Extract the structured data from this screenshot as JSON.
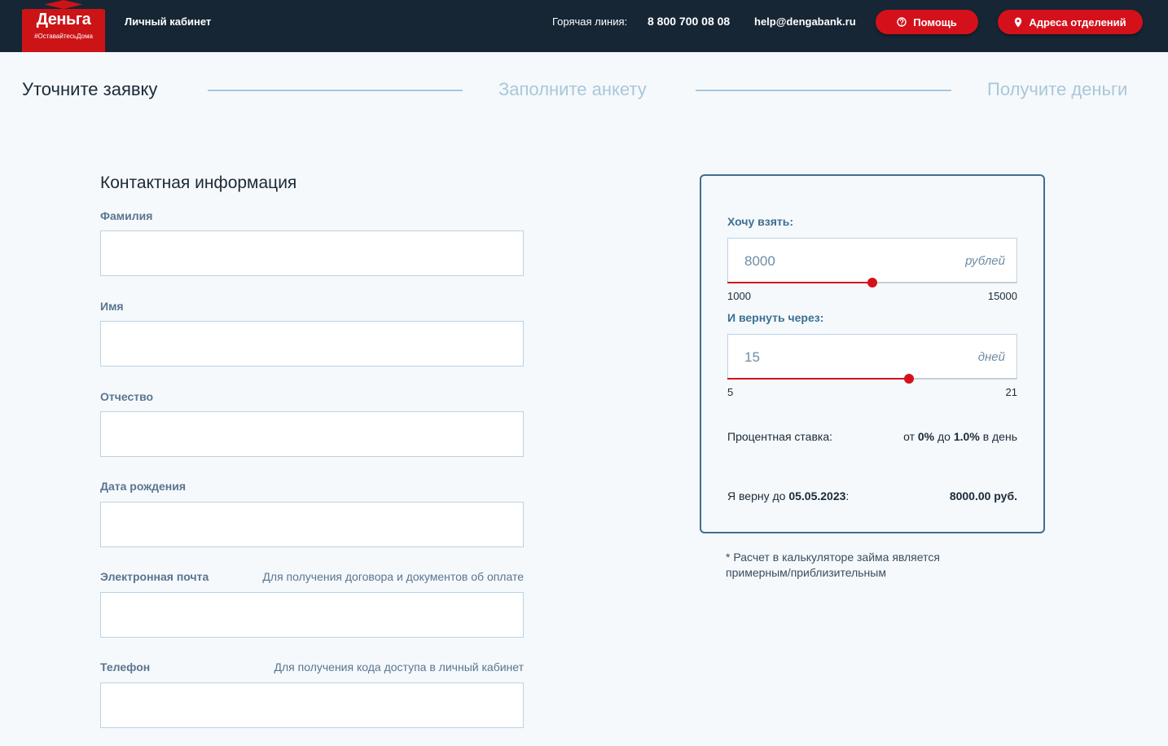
{
  "header": {
    "logo_text": "Деньга",
    "logo_sub": "#ОставайтесьДома",
    "cabinet_link": "Личный кабинет",
    "hotline_label": "Горячая линия:",
    "hotline_phone": "8 800 700 08 08",
    "email": "help@dengabank.ru",
    "help_button": "Помощь",
    "addresses_button": "Адреса отделений",
    "colors": {
      "bg": "#162635",
      "accent": "#d4111a"
    }
  },
  "steps": [
    {
      "label": "Уточните заявку",
      "active": true
    },
    {
      "label": "Заполните анкету",
      "active": false
    },
    {
      "label": "Получите деньги",
      "active": false
    }
  ],
  "form": {
    "title": "Контактная информация",
    "fields": [
      {
        "label": "Фамилия",
        "hint": "",
        "value": ""
      },
      {
        "label": "Имя",
        "hint": "",
        "value": ""
      },
      {
        "label": "Отчество",
        "hint": "",
        "value": ""
      },
      {
        "label": "Дата рождения",
        "hint": "",
        "value": ""
      },
      {
        "label": "Электронная почта",
        "hint": "Для получения договора и документов об оплате",
        "value": ""
      },
      {
        "label": "Телефон",
        "hint": "Для получения кода доступа в личный кабинет",
        "value": ""
      }
    ]
  },
  "calculator": {
    "amount_label": "Хочу взять:",
    "amount_value": "8000",
    "amount_unit": "рублей",
    "amount_min": "1000",
    "amount_max": "15000",
    "amount_fraction": 0.5,
    "term_label": "И вернуть через:",
    "term_value": "15",
    "term_unit": "дней",
    "term_min": "5",
    "term_max": "21",
    "term_fraction": 0.625,
    "rate_label": "Процентная ставка:",
    "rate_prefix": "от",
    "rate_from": "0%",
    "rate_mid": "до",
    "rate_to": "1.0%",
    "rate_suffix": "в день",
    "return_prefix": "Я верну до",
    "return_date": "05.05.2023",
    "return_colon": ":",
    "return_sum": "8000.00 руб.",
    "note": "* Расчет в калькуляторе займа является примерным/приблизительным"
  }
}
